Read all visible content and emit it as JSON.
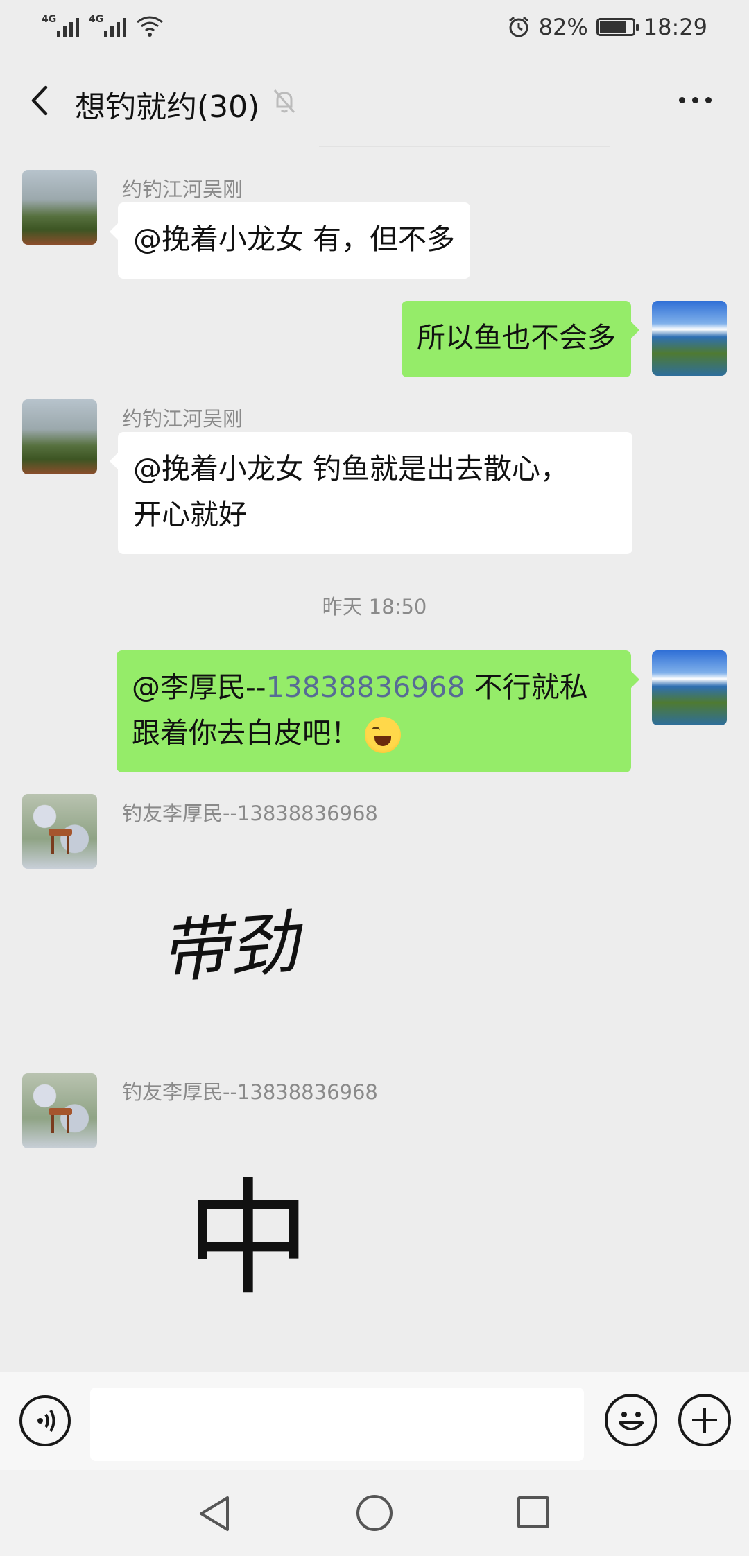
{
  "status_bar": {
    "network1": "4G",
    "network2": "4G",
    "battery_percent": "82%",
    "battery_level": 0.82,
    "time": "18:29"
  },
  "header": {
    "title": "想钓就约(30)"
  },
  "messages": [
    {
      "sender": "约钓江河吴刚",
      "text": "@挽着小龙女  有，但不多",
      "direction": "in"
    },
    {
      "text": "所以鱼也不会多",
      "direction": "out"
    },
    {
      "sender": "约钓江河吴刚",
      "line1": "@挽着小龙女  钓鱼就是出去散心，",
      "line2": "开心就好",
      "direction": "in"
    },
    {
      "timestamp": "昨天 18:50"
    },
    {
      "prefix": "@李厚民--",
      "phone": "13838836968",
      "suffix": " 不行就私",
      "line2": "跟着你去白皮吧！",
      "emoji": "face-with-tears-of-joy",
      "direction": "out"
    },
    {
      "sender": "钓友李厚民--13838836968",
      "sticker_text": "带劲",
      "direction": "in"
    },
    {
      "sender": "钓友李厚民--13838836968",
      "sticker_text": "中",
      "direction": "in"
    }
  ],
  "icons": {
    "back": "back-arrow-icon",
    "mute": "bell-muted-icon",
    "more": "more-dots-icon",
    "voice": "voice-icon",
    "emoji": "emoji-icon",
    "plus": "plus-icon"
  }
}
